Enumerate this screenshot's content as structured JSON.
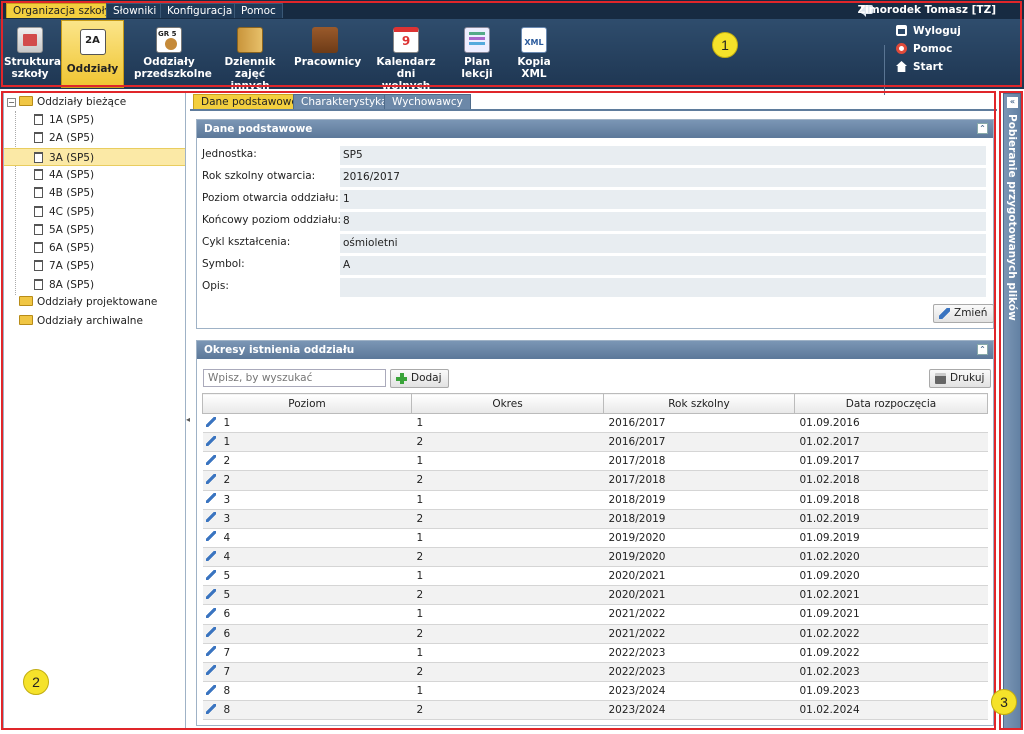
{
  "menubar": {
    "tabs": [
      "Organizacja szkoły",
      "Słowniki",
      "Konfiguracja",
      "Pomoc"
    ],
    "user": "Zimorodek Tomasz [TZ]"
  },
  "toolbar": {
    "items": [
      {
        "line1": "Struktura",
        "line2": "szkoły",
        "icon": "school-structure-icon"
      },
      {
        "line1": "Oddziały",
        "line2": "",
        "icon": "class-2a-icon",
        "icon_text": "2A"
      },
      {
        "line1": "Oddziały",
        "line2": "przedszkolne",
        "icon": "preschool-icon",
        "icon_text": "GR 5"
      },
      {
        "line1": "Dziennik",
        "line2": "zajęć innych",
        "icon": "diary-icon"
      },
      {
        "line1": "Pracownicy",
        "line2": "",
        "icon": "briefcase-icon"
      },
      {
        "line1": "Kalendarz dni",
        "line2": "wolnych",
        "icon": "calendar-icon",
        "icon_text": "9"
      },
      {
        "line1": "Plan",
        "line2": "lekcji",
        "icon": "schedule-icon"
      },
      {
        "line1": "Kopia",
        "line2": "XML",
        "icon": "xml-icon",
        "icon_text": "XML"
      }
    ],
    "quick_links": [
      "Wyloguj",
      "Pomoc",
      "Start"
    ]
  },
  "tree": {
    "current": "Oddziały bieżące",
    "classes": [
      "1A (SP5)",
      "2A (SP5)",
      "3A (SP5)",
      "4A (SP5)",
      "4B (SP5)",
      "4C (SP5)",
      "5A (SP5)",
      "6A (SP5)",
      "7A (SP5)",
      "8A (SP5)"
    ],
    "selected_index": 2,
    "projected": "Oddziały projektowane",
    "archived": "Oddziały archiwalne"
  },
  "tabs": [
    "Dane podstawowe",
    "Charakterystyka",
    "Wychowawcy"
  ],
  "basic": {
    "title": "Dane podstawowe",
    "fields": [
      {
        "label": "Jednostka:",
        "value": "SP5"
      },
      {
        "label": "Rok szkolny otwarcia:",
        "value": "2016/2017"
      },
      {
        "label": "Poziom otwarcia oddziału:",
        "value": "1"
      },
      {
        "label": "Końcowy poziom oddziału:",
        "value": "8"
      },
      {
        "label": "Cykl kształcenia:",
        "value": "ośmioletni"
      },
      {
        "label": "Symbol:",
        "value": "A"
      },
      {
        "label": "Opis:",
        "value": ""
      }
    ],
    "edit_label": "Zmień"
  },
  "periods": {
    "title": "Okresy istnienia oddziału",
    "search_placeholder": "Wpisz, by wyszukać",
    "add_label": "Dodaj",
    "print_label": "Drukuj",
    "columns": [
      "Poziom",
      "Okres",
      "Rok szkolny",
      "Data rozpoczęcia"
    ],
    "rows": [
      [
        "1",
        "1",
        "2016/2017",
        "01.09.2016"
      ],
      [
        "1",
        "2",
        "2016/2017",
        "01.02.2017"
      ],
      [
        "2",
        "1",
        "2017/2018",
        "01.09.2017"
      ],
      [
        "2",
        "2",
        "2017/2018",
        "01.02.2018"
      ],
      [
        "3",
        "1",
        "2018/2019",
        "01.09.2018"
      ],
      [
        "3",
        "2",
        "2018/2019",
        "01.02.2019"
      ],
      [
        "4",
        "1",
        "2019/2020",
        "01.09.2019"
      ],
      [
        "4",
        "2",
        "2019/2020",
        "01.02.2020"
      ],
      [
        "5",
        "1",
        "2020/2021",
        "01.09.2020"
      ],
      [
        "5",
        "2",
        "2020/2021",
        "01.02.2021"
      ],
      [
        "6",
        "1",
        "2021/2022",
        "01.09.2021"
      ],
      [
        "6",
        "2",
        "2021/2022",
        "01.02.2022"
      ],
      [
        "7",
        "1",
        "2022/2023",
        "01.09.2022"
      ],
      [
        "7",
        "2",
        "2022/2023",
        "01.02.2023"
      ],
      [
        "8",
        "1",
        "2023/2024",
        "01.09.2023"
      ],
      [
        "8",
        "2",
        "2023/2024",
        "01.02.2024"
      ]
    ]
  },
  "right_panel": {
    "title": "Pobieranie przygotowanych plików"
  },
  "annotations": [
    "1",
    "2",
    "3"
  ],
  "colors": {
    "accent": "#f3cf3e",
    "header": "#243e5a",
    "panel_header": "#5c7899",
    "annotation": "#e0262a",
    "badge": "#f5e22a"
  }
}
